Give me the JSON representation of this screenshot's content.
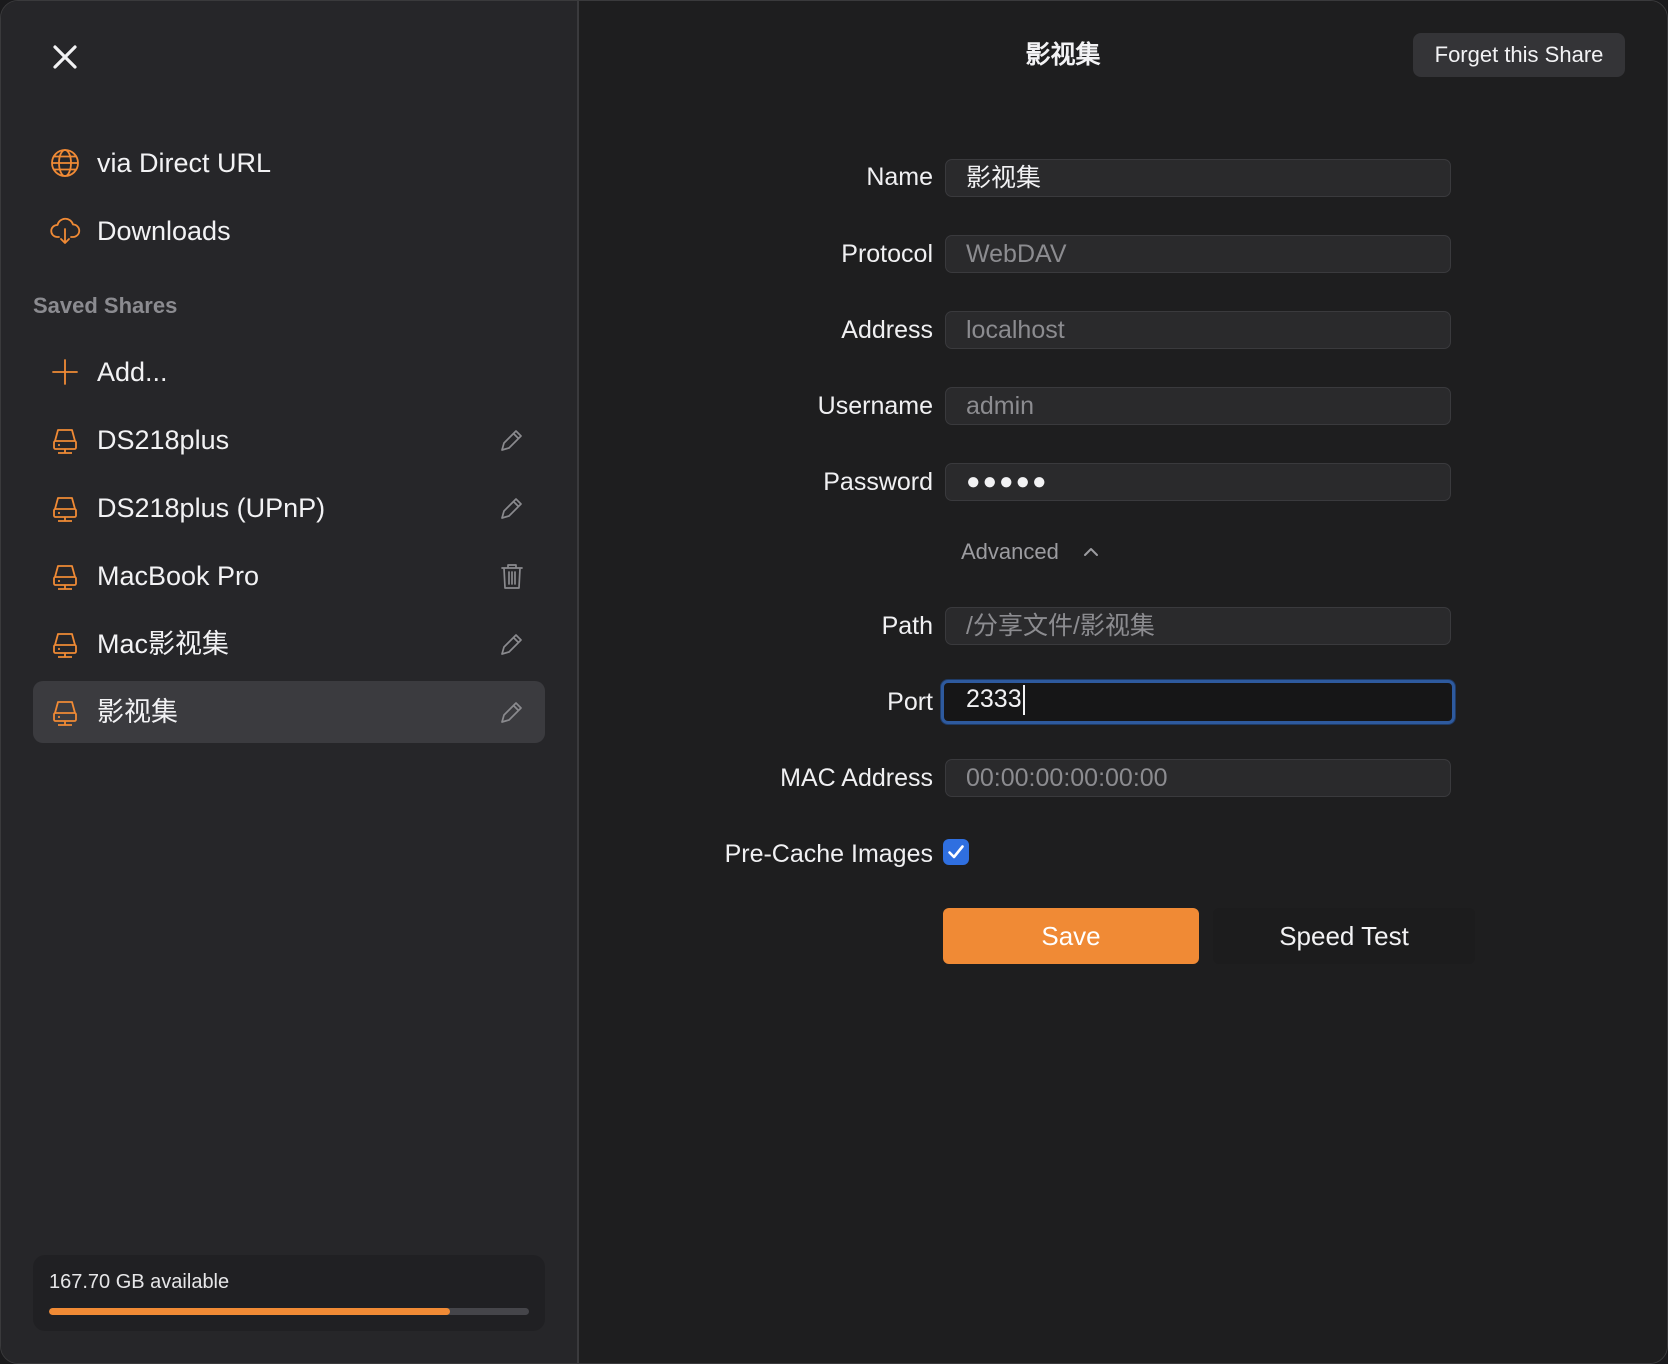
{
  "colors": {
    "accent": "#f08a35",
    "checkbox_blue": "#2f6fe0",
    "focus_ring": "#2e5a9e"
  },
  "sidebar": {
    "close_icon": "close-icon",
    "top_items": [
      {
        "label": "via Direct URL",
        "icon": "globe-icon"
      },
      {
        "label": "Downloads",
        "icon": "cloud-download-icon"
      }
    ],
    "section_title": "Saved Shares",
    "add_label": "Add...",
    "shares": [
      {
        "label": "DS218plus",
        "icon": "server-icon",
        "action": "pencil-icon"
      },
      {
        "label": "DS218plus (UPnP)",
        "icon": "server-icon",
        "action": "pencil-icon"
      },
      {
        "label": "MacBook Pro",
        "icon": "server-icon",
        "action": "trash-icon"
      },
      {
        "label": "Mac影视集",
        "icon": "server-icon",
        "action": "pencil-icon"
      },
      {
        "label": "影视集",
        "icon": "server-icon",
        "action": "pencil-icon",
        "selected": true
      }
    ],
    "storage": {
      "text": "167.70 GB available",
      "used_fraction": 0.835
    }
  },
  "main": {
    "title": "影视集",
    "forget_label": "Forget this Share",
    "fields": {
      "name": {
        "label": "Name",
        "value": "影视集"
      },
      "protocol": {
        "label": "Protocol",
        "value": "WebDAV"
      },
      "address": {
        "label": "Address",
        "placeholder": "localhost"
      },
      "username": {
        "label": "Username",
        "placeholder": "admin"
      },
      "password": {
        "label": "Password",
        "value": "●●●●●"
      },
      "path": {
        "label": "Path",
        "placeholder": "/分享文件/影视集"
      },
      "port": {
        "label": "Port",
        "value": "2333"
      },
      "mac": {
        "label": "MAC Address",
        "placeholder": "00:00:00:00:00:00"
      },
      "precache": {
        "label": "Pre-Cache Images",
        "checked": true
      }
    },
    "advanced_label": "Advanced",
    "save_label": "Save",
    "speed_test_label": "Speed Test"
  }
}
